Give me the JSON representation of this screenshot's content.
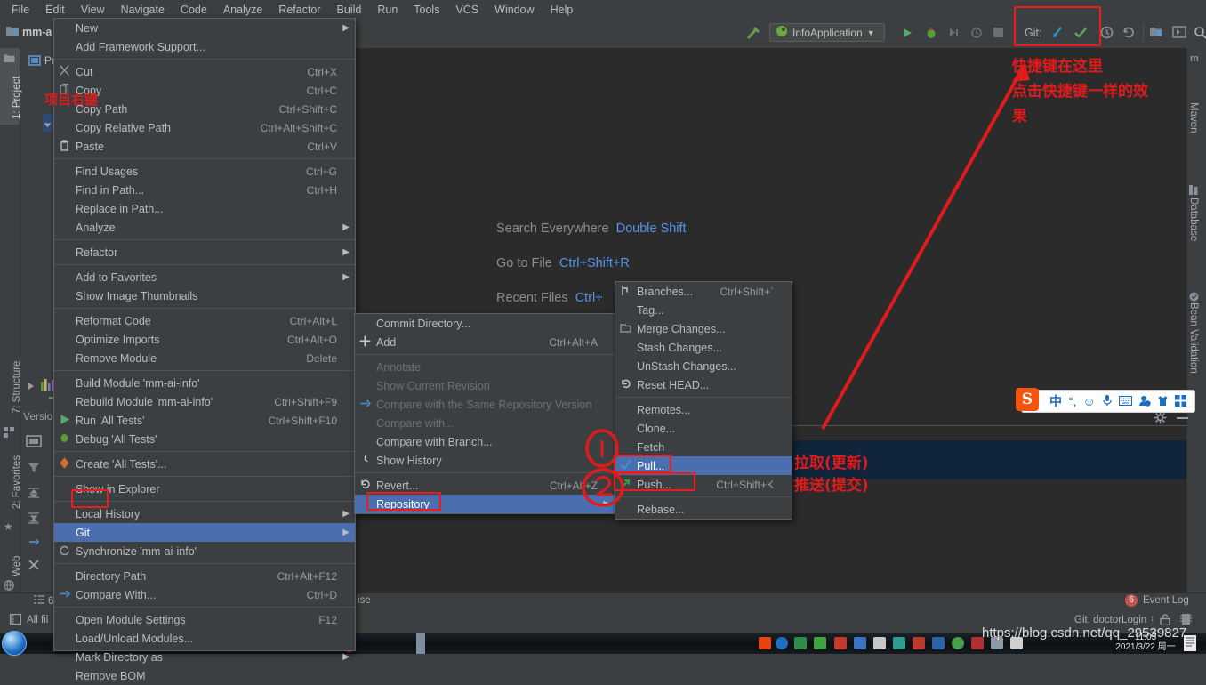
{
  "app": {
    "menubar": [
      "File",
      "Edit",
      "View",
      "Navigate",
      "Code",
      "Analyze",
      "Refactor",
      "Build",
      "Run",
      "Tools",
      "VCS",
      "Window",
      "Help"
    ],
    "project_title": "mm-a",
    "run_configuration": "InfoApplication",
    "git_toolbar_label": "Git:"
  },
  "editor_hints": [
    {
      "label": "Search Everywhere",
      "shortcut": "Double Shift"
    },
    {
      "label": "Go to File",
      "shortcut": "Ctrl+Shift+R"
    },
    {
      "label": "Recent Files",
      "shortcut": "Ctrl+"
    }
  ],
  "left_strip": [
    "1: Project",
    "7: Structure",
    "2: Favorites",
    "Web"
  ],
  "right_strip": [
    "Maven",
    "Database",
    "Bean Validation"
  ],
  "project_tree": [
    "Project"
  ],
  "context_menu": {
    "items": [
      {
        "label": "New",
        "shortcut": "",
        "icon": "",
        "arrow": true
      },
      {
        "label": "Add Framework Support...",
        "shortcut": "",
        "icon": "",
        "arrow": false
      },
      {
        "sep": true
      },
      {
        "label": "Cut",
        "shortcut": "Ctrl+X",
        "icon": "scissors-icon",
        "arrow": false
      },
      {
        "label": "Copy",
        "shortcut": "Ctrl+C",
        "icon": "copy-icon",
        "arrow": false
      },
      {
        "label": "Copy Path",
        "shortcut": "Ctrl+Shift+C",
        "icon": "",
        "arrow": false
      },
      {
        "label": "Copy Relative Path",
        "shortcut": "Ctrl+Alt+Shift+C",
        "icon": "",
        "arrow": false
      },
      {
        "label": "Paste",
        "shortcut": "Ctrl+V",
        "icon": "clipboard-icon",
        "arrow": false
      },
      {
        "sep": true
      },
      {
        "label": "Find Usages",
        "shortcut": "Ctrl+G",
        "icon": "",
        "arrow": false
      },
      {
        "label": "Find in Path...",
        "shortcut": "Ctrl+H",
        "icon": "",
        "arrow": false
      },
      {
        "label": "Replace in Path...",
        "shortcut": "",
        "icon": "",
        "arrow": false
      },
      {
        "label": "Analyze",
        "shortcut": "",
        "icon": "",
        "arrow": true
      },
      {
        "sep": true
      },
      {
        "label": "Refactor",
        "shortcut": "",
        "icon": "",
        "arrow": true
      },
      {
        "sep": true
      },
      {
        "label": "Add to Favorites",
        "shortcut": "",
        "icon": "",
        "arrow": true
      },
      {
        "label": "Show Image Thumbnails",
        "shortcut": "",
        "icon": "",
        "arrow": false
      },
      {
        "sep": true
      },
      {
        "label": "Reformat Code",
        "shortcut": "Ctrl+Alt+L",
        "icon": "",
        "arrow": false
      },
      {
        "label": "Optimize Imports",
        "shortcut": "Ctrl+Alt+O",
        "icon": "",
        "arrow": false
      },
      {
        "label": "Remove Module",
        "shortcut": "Delete",
        "icon": "",
        "arrow": false
      },
      {
        "sep": true
      },
      {
        "label": "Build Module 'mm-ai-info'",
        "shortcut": "",
        "icon": "",
        "arrow": false
      },
      {
        "label": "Rebuild Module 'mm-ai-info'",
        "shortcut": "Ctrl+Shift+F9",
        "icon": "",
        "arrow": false
      },
      {
        "label": "Run 'All Tests'",
        "shortcut": "Ctrl+Shift+F10",
        "icon": "run-icon",
        "arrow": false
      },
      {
        "label": "Debug 'All Tests'",
        "shortcut": "",
        "icon": "debug-icon",
        "arrow": false
      },
      {
        "sep": true
      },
      {
        "label": "Create 'All Tests'...",
        "shortcut": "",
        "icon": "create-test-icon",
        "arrow": false
      },
      {
        "sep": true
      },
      {
        "label": "Show in Explorer",
        "shortcut": "",
        "icon": "",
        "arrow": false
      },
      {
        "sep": true
      },
      {
        "label": "Local History",
        "shortcut": "",
        "icon": "",
        "arrow": true
      },
      {
        "label": "Git",
        "shortcut": "",
        "icon": "",
        "arrow": true,
        "selected": true
      },
      {
        "label": "Synchronize 'mm-ai-info'",
        "shortcut": "",
        "icon": "refresh-icon",
        "arrow": false
      },
      {
        "sep": true
      },
      {
        "label": "Directory Path",
        "shortcut": "Ctrl+Alt+F12",
        "icon": "",
        "arrow": false
      },
      {
        "label": "Compare With...",
        "shortcut": "Ctrl+D",
        "icon": "compare-icon",
        "arrow": false
      },
      {
        "sep": true
      },
      {
        "label": "Open Module Settings",
        "shortcut": "F12",
        "icon": "",
        "arrow": false
      },
      {
        "label": "Load/Unload Modules...",
        "shortcut": "",
        "icon": "",
        "arrow": false
      },
      {
        "label": "Mark Directory as",
        "shortcut": "",
        "icon": "",
        "arrow": true
      },
      {
        "label": "Remove BOM",
        "shortcut": "",
        "icon": "",
        "arrow": false
      }
    ]
  },
  "git_menu": {
    "items": [
      {
        "label": "Commit Directory...",
        "shortcut": "",
        "icon": "",
        "arrow": false
      },
      {
        "label": "Add",
        "shortcut": "Ctrl+Alt+A",
        "icon": "plus-icon",
        "arrow": false
      },
      {
        "sep": true
      },
      {
        "label": "Annotate",
        "shortcut": "",
        "icon": "",
        "arrow": false,
        "disabled": true
      },
      {
        "label": "Show Current Revision",
        "shortcut": "",
        "icon": "",
        "arrow": false,
        "disabled": true
      },
      {
        "label": "Compare with the Same Repository Version",
        "shortcut": "",
        "icon": "compare-icon",
        "arrow": false,
        "disabled": true
      },
      {
        "label": "Compare with...",
        "shortcut": "",
        "icon": "",
        "arrow": false,
        "disabled": true
      },
      {
        "label": "Compare with Branch...",
        "shortcut": "",
        "icon": "",
        "arrow": false
      },
      {
        "label": "Show History",
        "shortcut": "",
        "icon": "history-icon",
        "arrow": false
      },
      {
        "sep": true
      },
      {
        "label": "Revert...",
        "shortcut": "Ctrl+Alt+Z",
        "icon": "revert-icon",
        "arrow": false
      },
      {
        "label": "Repository",
        "shortcut": "",
        "icon": "",
        "arrow": true,
        "selected": true
      }
    ]
  },
  "repository_menu": {
    "items": [
      {
        "label": "Branches...",
        "shortcut": "Ctrl+Shift+`",
        "icon": "branch-icon",
        "arrow": false
      },
      {
        "label": "Tag...",
        "shortcut": "",
        "icon": "",
        "arrow": false
      },
      {
        "label": "Merge Changes...",
        "shortcut": "",
        "icon": "merge-icon",
        "arrow": false
      },
      {
        "label": "Stash Changes...",
        "shortcut": "",
        "icon": "",
        "arrow": false
      },
      {
        "label": "UnStash Changes...",
        "shortcut": "",
        "icon": "",
        "arrow": false
      },
      {
        "label": "Reset HEAD...",
        "shortcut": "",
        "icon": "reset-icon",
        "arrow": false
      },
      {
        "sep": true
      },
      {
        "label": "Remotes...",
        "shortcut": "",
        "icon": "",
        "arrow": false
      },
      {
        "label": "Clone...",
        "shortcut": "",
        "icon": "",
        "arrow": false
      },
      {
        "label": "Fetch",
        "shortcut": "",
        "icon": "",
        "arrow": false
      },
      {
        "label": "Pull...",
        "shortcut": "",
        "icon": "pull-icon",
        "arrow": false,
        "selected": true
      },
      {
        "label": "Push...",
        "shortcut": "Ctrl+Shift+K",
        "icon": "push-icon",
        "arrow": false
      },
      {
        "sep": true
      },
      {
        "label": "Rebase...",
        "shortcut": "",
        "icon": "",
        "arrow": false
      }
    ]
  },
  "annotations": {
    "project_right_click": "项目右键",
    "toolbar_note_line1": "快捷键在这里",
    "toolbar_note_line2": "点击快捷键一样的效",
    "toolbar_note_line3": "果",
    "pull_note": "拉取(更新)",
    "push_note": "推送(提交)"
  },
  "bottom": {
    "event_log": "Event Log",
    "event_log_count": "6",
    "git_branch": "Git: doctorLogin",
    "version_control": "Versio",
    "tab_6": "6:",
    "all_files": "All fil",
    "editor_tab_fragment": "ise"
  },
  "ime": {
    "brand": "S",
    "mode": "中",
    "icons": [
      "half-full-width-icon",
      "emoji-icon",
      "voice-input-icon",
      "keyboard-icon",
      "user-icon",
      "skin-icon",
      "apps-icon"
    ]
  },
  "taskbar": {
    "clock_time": "11:05",
    "clock_date": "2021/3/22 周一"
  },
  "watermark": "https://blog.csdn.net/qq_29539827",
  "colors": {
    "accent_red": "#ee1b1b",
    "selection_blue": "#4b6eaf",
    "link_blue": "#5394ec",
    "panel_bg": "#3c3f41",
    "editor_bg": "#2b2b2b"
  }
}
